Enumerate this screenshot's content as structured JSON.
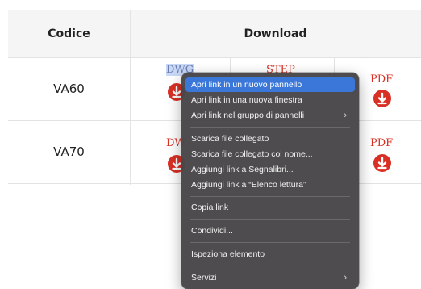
{
  "table": {
    "headers": {
      "code": "Codice",
      "download": "Download"
    },
    "rows": [
      {
        "code": "VA60",
        "dwg": "DWG",
        "step": "STEP",
        "pdf": "PDF"
      },
      {
        "code": "VA70",
        "dwg": "DW",
        "pdf": "PDF"
      }
    ]
  },
  "context_menu": {
    "items": [
      {
        "label": "Apri link in un nuovo pannello"
      },
      {
        "label": "Apri link in una nuova finestra"
      },
      {
        "label": "Apri link nel gruppo di pannelli",
        "submenu": true
      },
      {
        "label": "Scarica file collegato"
      },
      {
        "label": "Scarica file collegato col nome..."
      },
      {
        "label": "Aggiungi link a Segnalibri..."
      },
      {
        "label": "Aggiungi link a “Elenco lettura”"
      },
      {
        "label": "Copia link"
      },
      {
        "label": "Condividi..."
      },
      {
        "label": "Ispeziona elemento"
      },
      {
        "label": "Servizi",
        "submenu": true
      }
    ],
    "chevron": "›"
  },
  "colors": {
    "accent_red": "#d93025",
    "menu_bg": "#484648",
    "highlight": "#3b76d9"
  }
}
